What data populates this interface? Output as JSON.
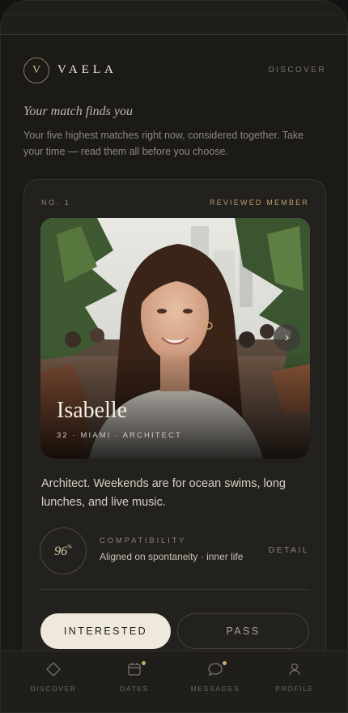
{
  "app": {
    "logo_letter": "V",
    "wordmark": "VAELA",
    "nav_label": "DISCOVER"
  },
  "intro": {
    "headline": "Your match finds you",
    "subtext": "Your five highest matches right now, considered together. Take your time — read them all before you choose."
  },
  "card": {
    "rank": "NO. 1",
    "badge": "REVIEWED MEMBER",
    "name": "Isabelle",
    "meta": "32 · MIAMI · ARCHITECT",
    "bio": "Architect. Weekends are for ocean swims, long lunches, and live music.",
    "compatibility": {
      "value": "96",
      "unit": "%",
      "label": "COMPATIBILITY",
      "description": "Aligned on spontaneity · inner life",
      "detail_label": "DETAIL"
    },
    "actions": {
      "interested": "INTERESTED",
      "pass": "PASS"
    }
  },
  "tabs": [
    {
      "label": "DISCOVER",
      "icon": "diamond-icon",
      "badge": false
    },
    {
      "label": "DATES",
      "icon": "calendar-icon",
      "badge": true
    },
    {
      "label": "MESSAGES",
      "icon": "chat-bubble-icon",
      "badge": true
    },
    {
      "label": "PROFILE",
      "icon": "person-icon",
      "badge": false
    }
  ],
  "colors": {
    "accent": "#b89e6e",
    "background": "#1b1a17",
    "card": "#23211e",
    "primary_button": "#efe8dc"
  }
}
